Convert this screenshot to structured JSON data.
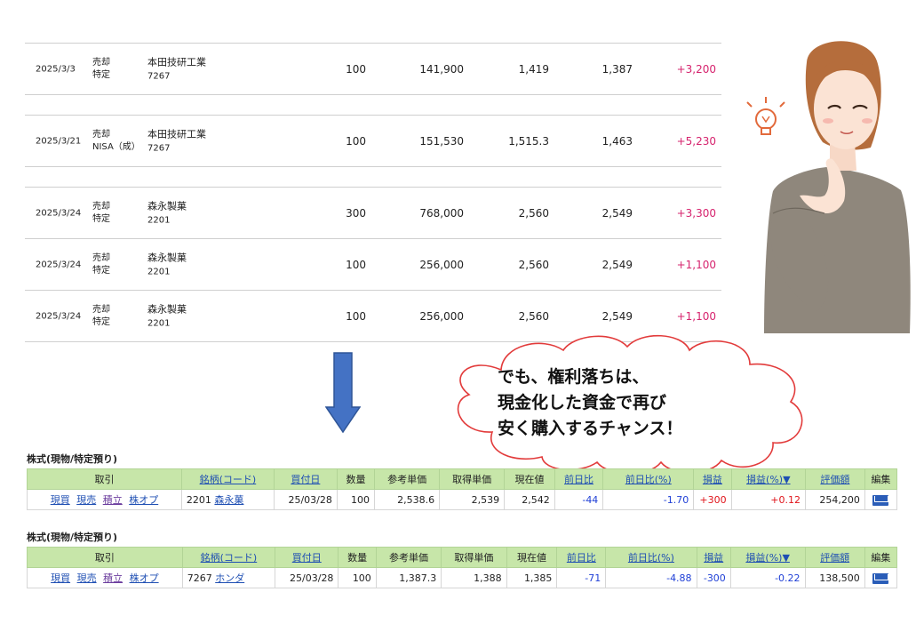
{
  "history": {
    "rows": [
      {
        "date": "2025/3/3",
        "side": "売却",
        "account": "特定",
        "name": "本田技研工業",
        "code": "7267",
        "qty": "100",
        "amount": "141,900",
        "unit_price": "1,419",
        "current": "1,387",
        "pl": "+3,200"
      },
      {
        "date": "2025/3/21",
        "side": "売却",
        "account": "NISA（成）",
        "name": "本田技研工業",
        "code": "7267",
        "qty": "100",
        "amount": "151,530",
        "unit_price": "1,515.3",
        "current": "1,463",
        "pl": "+5,230"
      },
      {
        "date": "2025/3/24",
        "side": "売却",
        "account": "特定",
        "name": "森永製菓",
        "code": "2201",
        "qty": "300",
        "amount": "768,000",
        "unit_price": "2,560",
        "current": "2,549",
        "pl": "+3,300"
      },
      {
        "date": "2025/3/24",
        "side": "売却",
        "account": "特定",
        "name": "森永製菓",
        "code": "2201",
        "qty": "100",
        "amount": "256,000",
        "unit_price": "2,560",
        "current": "2,549",
        "pl": "+1,100"
      },
      {
        "date": "2025/3/24",
        "side": "売却",
        "account": "特定",
        "name": "森永製菓",
        "code": "2201",
        "qty": "100",
        "amount": "256,000",
        "unit_price": "2,560",
        "current": "2,549",
        "pl": "+1,100"
      }
    ]
  },
  "bubble": {
    "line1": "でも、権利落ちは、",
    "line2": "現金化した資金で再び",
    "line3": "安く購入するチャンス！"
  },
  "holdings_header": {
    "trade": "取引",
    "symbol": "銘柄(コード)",
    "buy_date": "買付日",
    "qty": "数量",
    "ref_price": "参考単価",
    "cost": "取得単価",
    "current": "現在値",
    "change": "前日比",
    "change_pct": "前日比(%)",
    "pl": "損益",
    "pl_pct": "損益(%)▼",
    "value": "評価額",
    "edit": "編集"
  },
  "trade_buttons": {
    "buy": "現買",
    "sell": "現売",
    "accum": "積立",
    "option": "株オプ"
  },
  "holdings": [
    {
      "title": "株式(現物/特定預り)",
      "code": "2201",
      "name": "森永菓",
      "buy_date": "25/03/28",
      "qty": "100",
      "ref_price": "2,538.6",
      "cost": "2,539",
      "current": "2,542",
      "change": "-44",
      "change_pct": "-1.70",
      "pl": "+300",
      "pl_pct": "+0.12",
      "value": "254,200"
    },
    {
      "title": "株式(現物/特定預り)",
      "code": "7267",
      "name": "ホンダ",
      "buy_date": "25/03/28",
      "qty": "100",
      "ref_price": "1,387.3",
      "cost": "1,388",
      "current": "1,385",
      "change": "-71",
      "change_pct": "-4.88",
      "pl": "-300",
      "pl_pct": "-0.22",
      "value": "138,500"
    }
  ],
  "colors": {
    "header_bg": "#c7e6a9",
    "positive": "#d6246e",
    "link": "#1f4fb3",
    "arrow": "#4472c4",
    "cloud_stroke": "#e23b3b"
  }
}
